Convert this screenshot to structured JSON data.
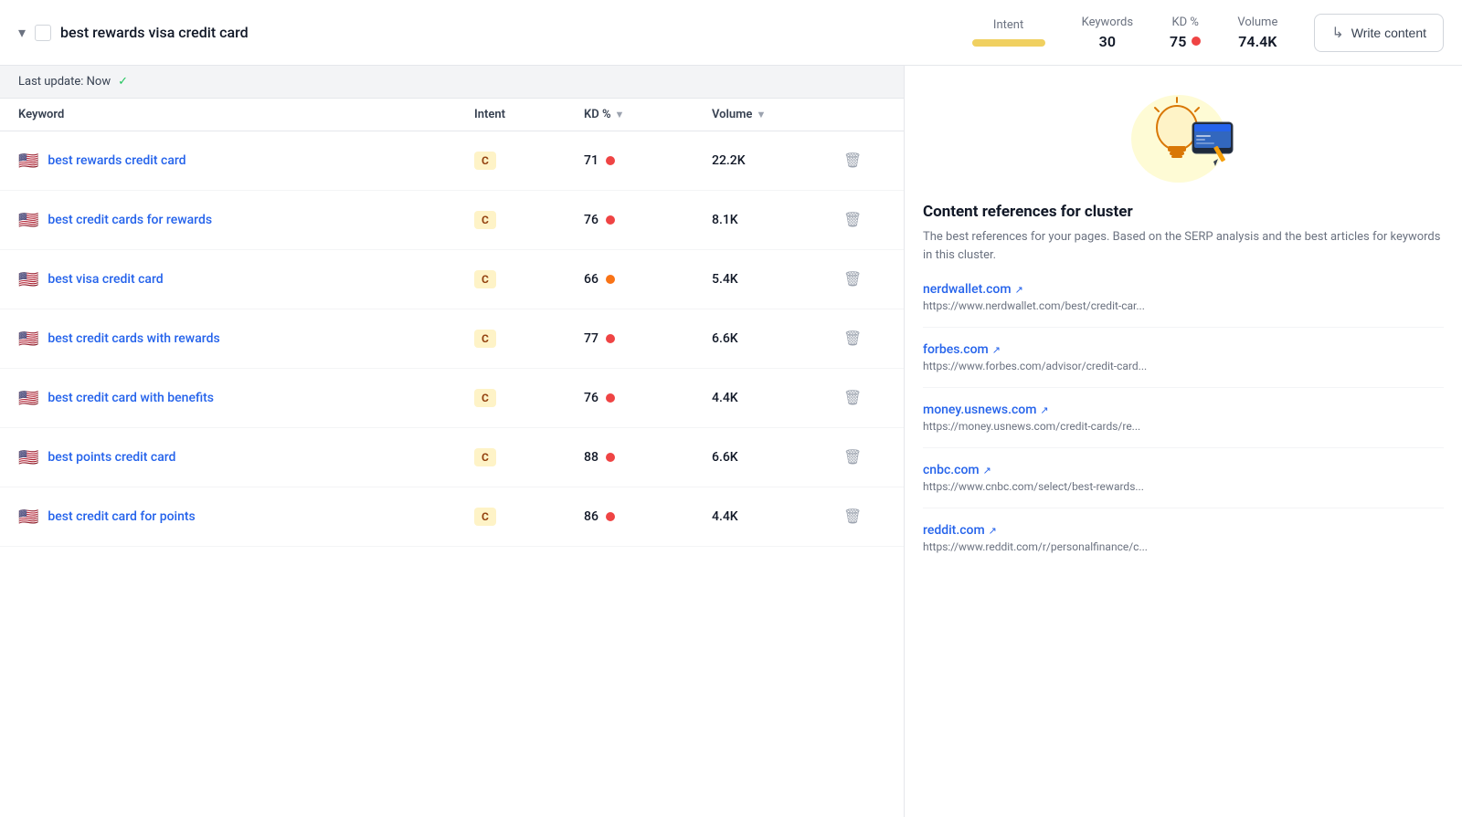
{
  "topBar": {
    "title": "best rewards visa credit card",
    "intentLabel": "Intent",
    "keywordsLabel": "Keywords",
    "keywordsValue": "30",
    "kdLabel": "KD %",
    "kdValue": "75",
    "volumeLabel": "Volume",
    "volumeValue": "74.4K",
    "writeBtnLabel": "Write content"
  },
  "updateBar": {
    "text": "Last update: Now",
    "checkmark": "✓"
  },
  "tableHeaders": {
    "keyword": "Keyword",
    "intent": "Intent",
    "kd": "KD %",
    "volume": "Volume"
  },
  "rows": [
    {
      "flag": "🇺🇸",
      "keyword": "best rewards credit card",
      "intent": "C",
      "kd": "71",
      "kdDot": "red",
      "volume": "22.2K",
      "volDot": "red"
    },
    {
      "flag": "🇺🇸",
      "keyword": "best credit cards for rewards",
      "intent": "C",
      "kd": "76",
      "kdDot": "red",
      "volume": "8.1K",
      "volDot": "red"
    },
    {
      "flag": "🇺🇸",
      "keyword": "best visa credit card",
      "intent": "C",
      "kd": "66",
      "kdDot": "orange",
      "volume": "5.4K",
      "volDot": "orange"
    },
    {
      "flag": "🇺🇸",
      "keyword": "best credit cards with rewards",
      "intent": "C",
      "kd": "77",
      "kdDot": "red",
      "volume": "6.6K",
      "volDot": "red"
    },
    {
      "flag": "🇺🇸",
      "keyword": "best credit card with benefits",
      "intent": "C",
      "kd": "76",
      "kdDot": "red",
      "volume": "4.4K",
      "volDot": "red"
    },
    {
      "flag": "🇺🇸",
      "keyword": "best points credit card",
      "intent": "C",
      "kd": "88",
      "kdDot": "red",
      "volume": "6.6K",
      "volDot": "red"
    },
    {
      "flag": "🇺🇸",
      "keyword": "best credit card for points",
      "intent": "C",
      "kd": "86",
      "kdDot": "red",
      "volume": "4.4K",
      "volDot": "red"
    }
  ],
  "rightPanel": {
    "title": "Content references for cluster",
    "description": "The best references for your pages. Based on the SERP analysis and the best articles for keywords in this cluster.",
    "references": [
      {
        "domain": "nerdwallet.com",
        "url": "https://www.nerdwallet.com/best/credit-car..."
      },
      {
        "domain": "forbes.com",
        "url": "https://www.forbes.com/advisor/credit-card..."
      },
      {
        "domain": "money.usnews.com",
        "url": "https://money.usnews.com/credit-cards/re..."
      },
      {
        "domain": "cnbc.com",
        "url": "https://www.cnbc.com/select/best-rewards..."
      },
      {
        "domain": "reddit.com",
        "url": "https://www.reddit.com/r/personalfinance/c..."
      }
    ]
  }
}
